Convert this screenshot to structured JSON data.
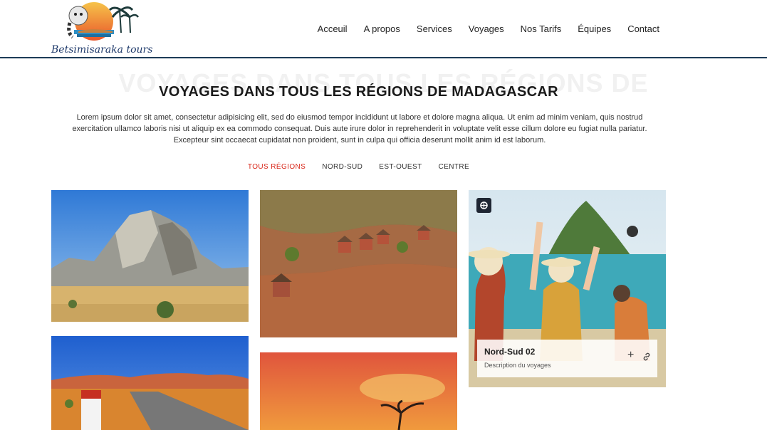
{
  "brand": {
    "logo_text": "Betsimisaraka tours"
  },
  "nav": {
    "items": [
      "Acceuil",
      "A propos",
      "Services",
      "Voyages",
      "Nos Tarifs",
      "Équipes",
      "Contact"
    ]
  },
  "section": {
    "background_title": "VOYAGES DANS TOUS LES RÉGIONS DE",
    "title": "VOYAGES DANS TOUS LES RÉGIONS DE MADAGASCAR",
    "description": "Lorem ipsum dolor sit amet, consectetur adipisicing elit, sed do eiusmod tempor incididunt ut labore et dolore magna aliqua. Ut enim ad minim veniam, quis nostrud exercitation ullamco laboris nisi ut aliquip ex ea commodo consequat. Duis aute irure dolor in reprehenderit in voluptate velit esse cillum dolore eu fugiat nulla pariatur. Excepteur sint occaecat cupidatat non proident, sunt in culpa qui officia deserunt mollit anim id est laborum."
  },
  "filters": {
    "items": [
      "TOUS RÉGIONS",
      "NORD-SUD",
      "EST-OUEST",
      "CENTRE"
    ],
    "active_index": 0
  },
  "gallery": {
    "hover_card": {
      "title": "Nord-Sud 02",
      "description": "Description du voyages"
    }
  },
  "colors": {
    "accent": "#d9291c",
    "header_border": "#1d3b57",
    "badge": "#1f2633"
  }
}
